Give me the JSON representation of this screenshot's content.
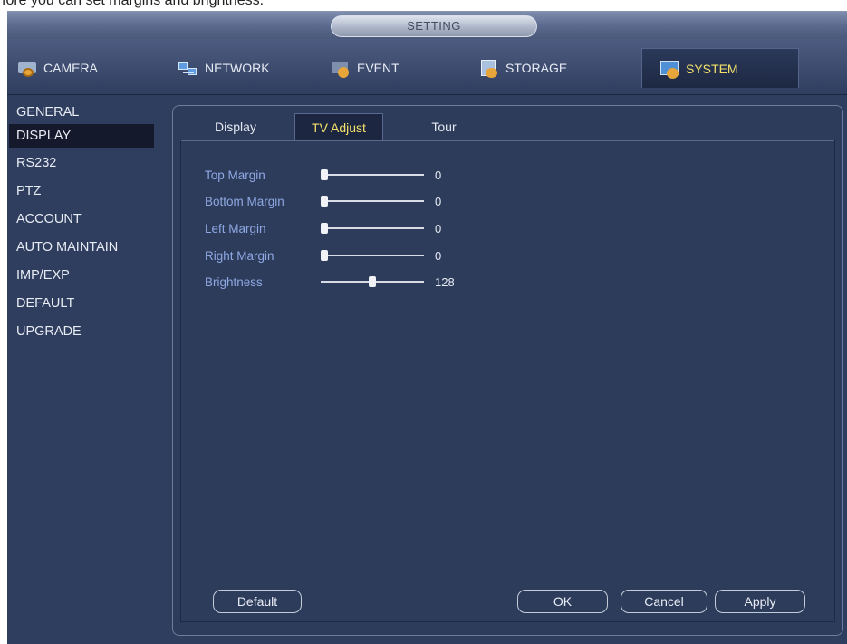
{
  "caption_fragment": "fore you can set margins and brightness.",
  "window": {
    "title": "SETTING"
  },
  "main_tabs": [
    {
      "label": "CAMERA",
      "icon": "camera-icon"
    },
    {
      "label": "NETWORK",
      "icon": "network-icon"
    },
    {
      "label": "EVENT",
      "icon": "event-icon"
    },
    {
      "label": "STORAGE",
      "icon": "storage-icon"
    },
    {
      "label": "SYSTEM",
      "icon": "system-icon",
      "active": true
    }
  ],
  "sidebar": {
    "items": [
      {
        "label": "GENERAL"
      },
      {
        "label": "DISPLAY",
        "active": true
      },
      {
        "label": "RS232"
      },
      {
        "label": "PTZ"
      },
      {
        "label": "ACCOUNT"
      },
      {
        "label": "AUTO MAINTAIN"
      },
      {
        "label": "IMP/EXP"
      },
      {
        "label": "DEFAULT"
      },
      {
        "label": "UPGRADE"
      }
    ]
  },
  "sub_tabs": [
    {
      "label": "Display"
    },
    {
      "label": "TV Adjust",
      "active": true
    },
    {
      "label": "Tour"
    }
  ],
  "settings": [
    {
      "label": "Top Margin",
      "value": "0",
      "level": 0
    },
    {
      "label": "Bottom Margin",
      "value": "0",
      "level": 0
    },
    {
      "label": "Left Margin",
      "value": "0",
      "level": 0
    },
    {
      "label": "Right Margin",
      "value": "0",
      "level": 0
    },
    {
      "label": "Brightness",
      "value": "128",
      "level": 0.5
    }
  ],
  "buttons": {
    "default": "Default",
    "ok": "OK",
    "cancel": "Cancel",
    "apply": "Apply"
  },
  "colors": {
    "background": "#2f3e5e",
    "active_tab_text": "#f3e06a",
    "setting_label": "#8ea8e2"
  }
}
